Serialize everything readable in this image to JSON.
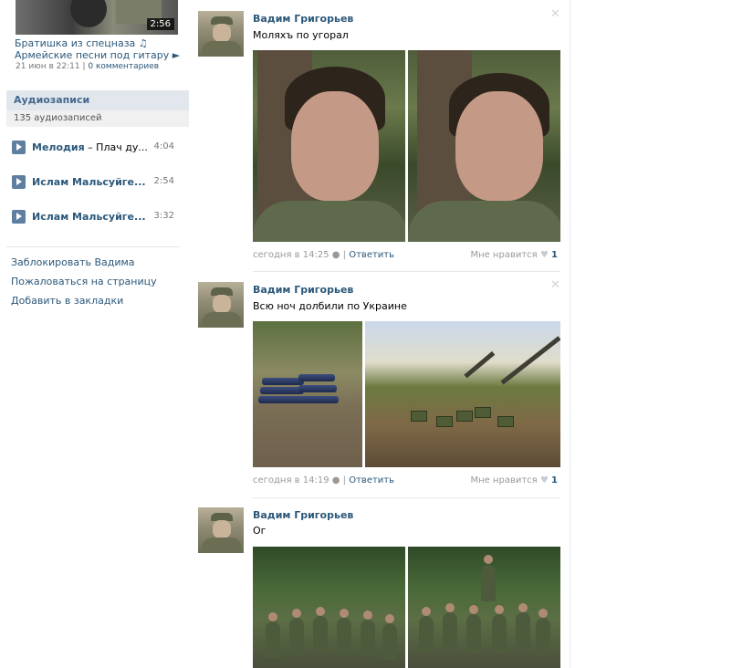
{
  "sidebar": {
    "video": {
      "duration": "2:56",
      "title": "Братишка из спецназа ♫",
      "subtitle": "Армейские песни под гитару ►",
      "date": "21 июн в 22:11",
      "comments": "0 комментариев"
    },
    "audio": {
      "header": "Аудиозаписи",
      "count": "135 аудиозаписей",
      "tracks": [
        {
          "artist": "Мелодия",
          "song": " – Плач ду...",
          "duration": "4:04"
        },
        {
          "artist": "Ислам Мальсуйге...",
          "song": "",
          "duration": "2:54"
        },
        {
          "artist": "Ислам Мальсуйге...",
          "song": "",
          "duration": "3:32"
        }
      ]
    },
    "links": [
      "Заблокировать Вадима",
      "Пожаловаться на страницу",
      "Добавить в закладки"
    ]
  },
  "posts": [
    {
      "author": "Вадим Григорьев",
      "text": "Моляхъ по угорал",
      "time": "сегодня в 14:25",
      "reply": "Ответить",
      "like_label": "Мне нравится",
      "likes": "1"
    },
    {
      "author": "Вадим Григорьев",
      "text": "Всю ноч долбили по Украине",
      "time": "сегодня в 14:19",
      "reply": "Ответить",
      "like_label": "Мне нравится",
      "likes": "1"
    },
    {
      "author": "Вадим Григорьев",
      "text": "Ог"
    }
  ],
  "icons": {
    "close": "close-icon",
    "heart": "heart-icon",
    "apple": "apple-icon",
    "play": "play-icon"
  },
  "colors": {
    "link": "#2b587a",
    "header_bg": "#e1e7ed",
    "muted": "#999999"
  }
}
